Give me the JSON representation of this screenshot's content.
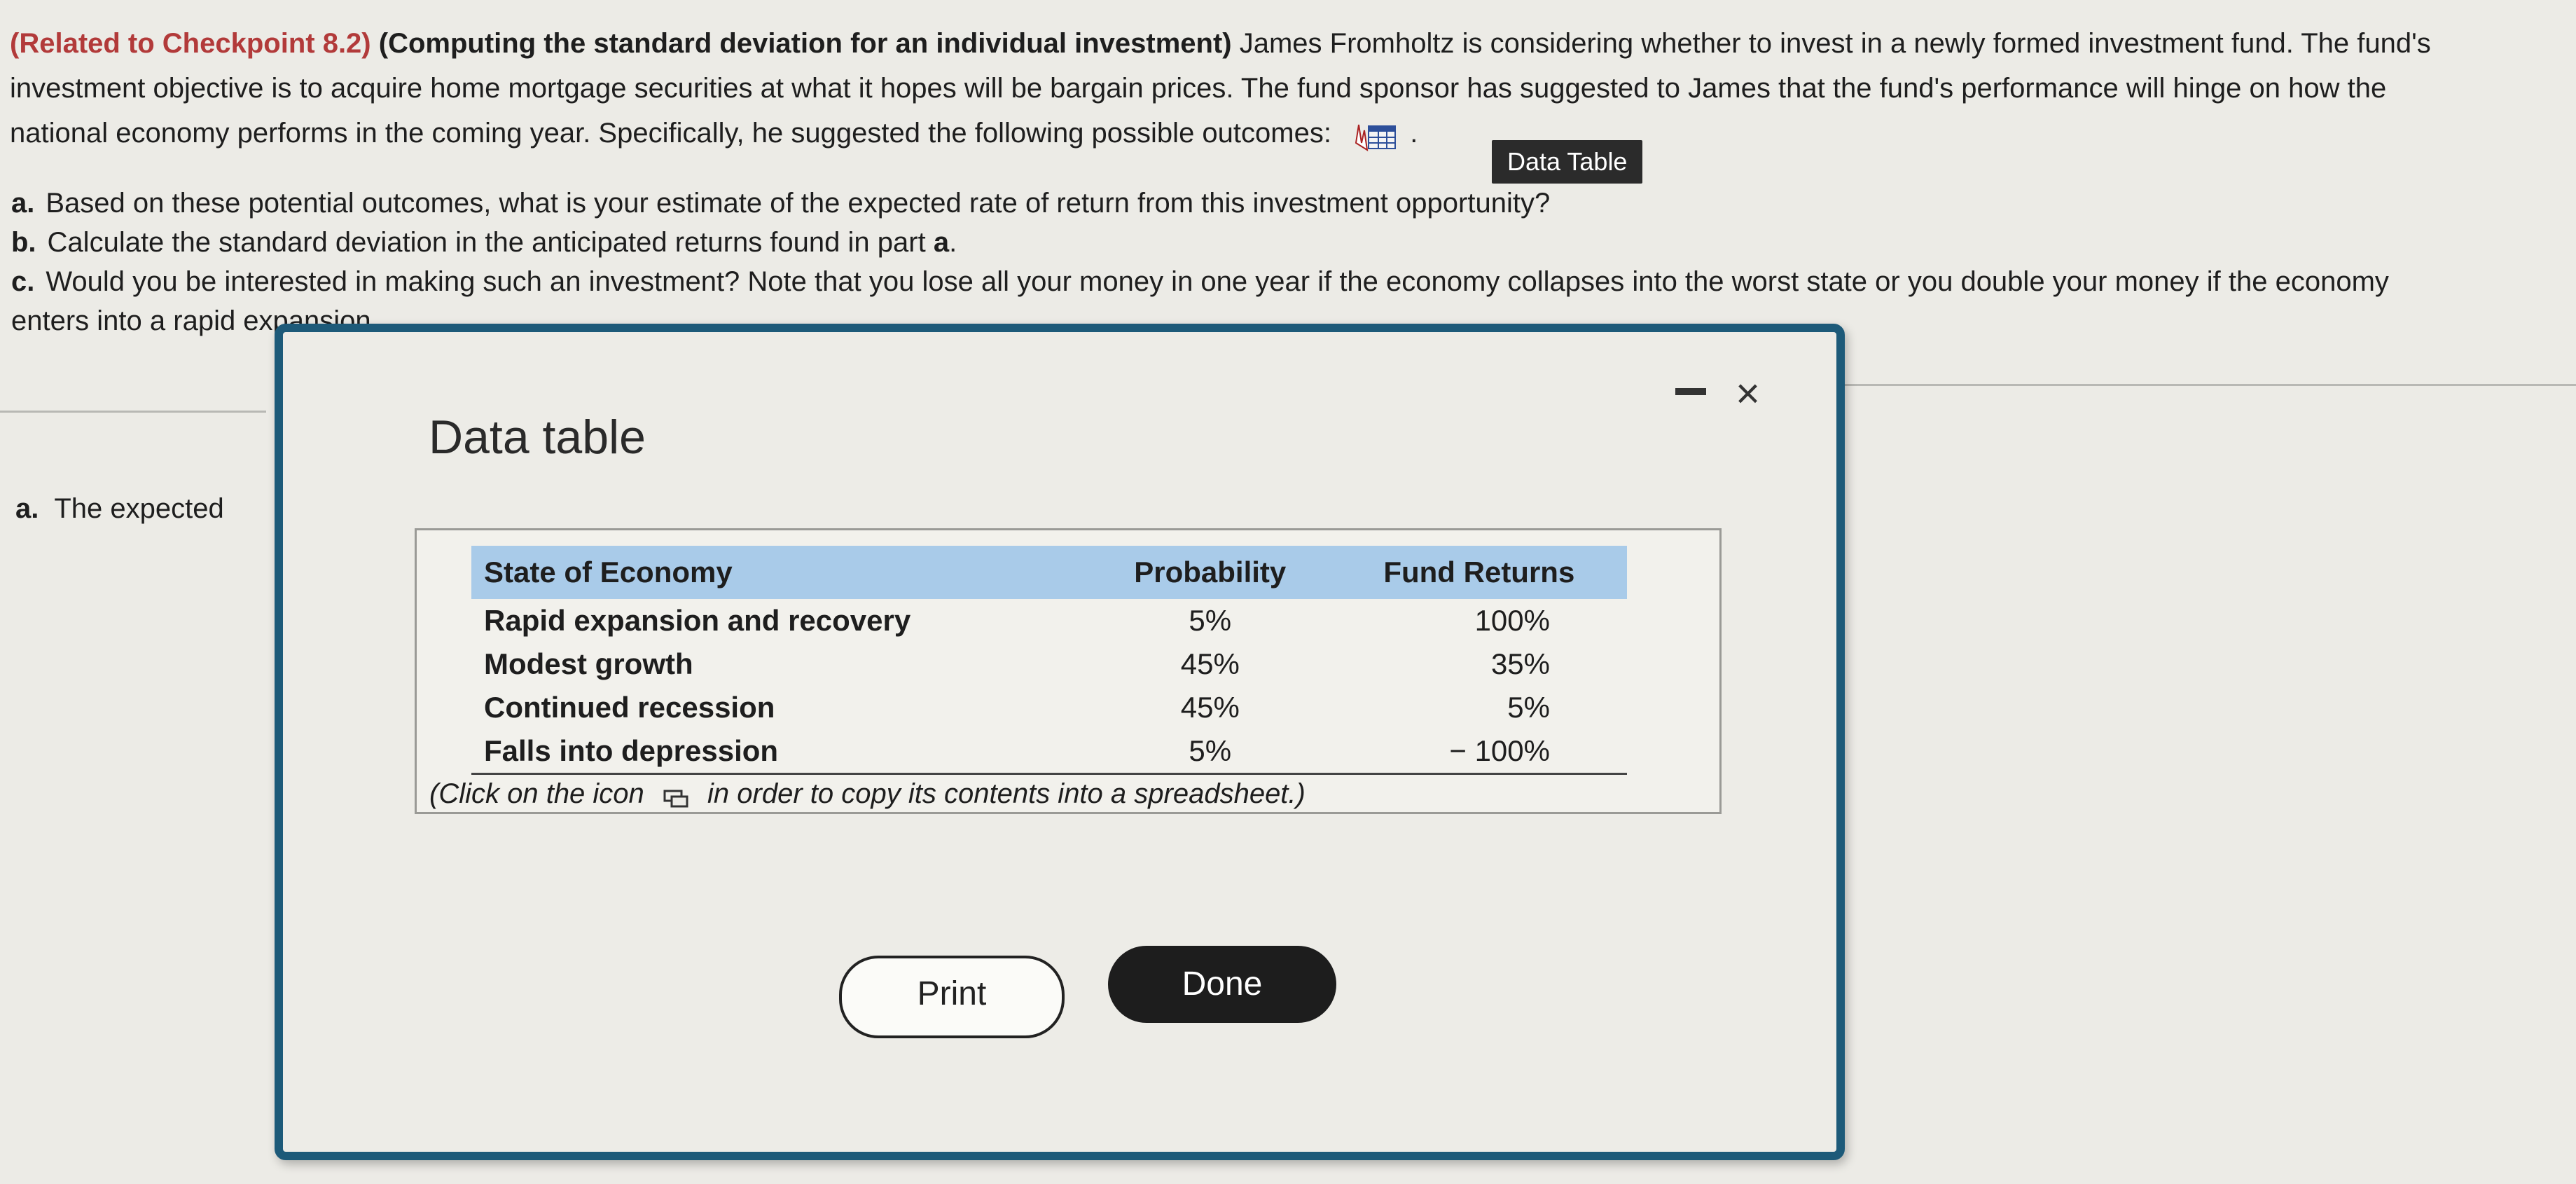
{
  "problem": {
    "ref": "(Related to Checkpoint 8.2)",
    "topic": "(Computing the standard deviation for an individual investment)",
    "body_line1": "James Fromholtz is considering whether to invest in a newly formed investment fund.  The fund's",
    "body_line2": "investment objective is to acquire home mortgage securities at what it hopes will be bargain prices.  The fund sponsor has suggested to James that the fund's performance will hinge on how the",
    "body_line3": "national economy performs in the coming year.  Specifically, he suggested the following possible outcomes:",
    "period": ".",
    "tooltip": "Data Table",
    "part_a_label": "a.",
    "part_a": "Based on these potential outcomes, what is your estimate of the expected rate of return from this investment opportunity?",
    "part_b_label": "b.",
    "part_b_pre": "Calculate the standard deviation in the anticipated returns found in part ",
    "part_b_ref": "a",
    "part_b_post": ".",
    "part_c_label": "c.",
    "part_c_line1": "Would you be interested in making such an investment?  Note that you lose all your money in one year if the economy collapses into the worst state or you double your money if the economy",
    "part_c_line2": "enters into a rapid expansion."
  },
  "answer": {
    "label": "a.",
    "text": "The expected"
  },
  "modal": {
    "title": "Data table",
    "close": "×",
    "hint_pre": "(Click on the icon",
    "hint_post": "in order to copy its contents into a spreadsheet.)",
    "print_label": "Print",
    "done_label": "Done"
  },
  "table": {
    "headers": [
      "State of Economy",
      "Probability",
      "Fund Returns"
    ],
    "rows": [
      {
        "state": "Rapid expansion and recovery",
        "probability": "5%",
        "returns": "100%"
      },
      {
        "state": "Modest growth",
        "probability": "45%",
        "returns": "35%"
      },
      {
        "state": "Continued recession",
        "probability": "45%",
        "returns": "5%"
      },
      {
        "state": "Falls into depression",
        "probability": "5%",
        "returns": "− 100%"
      }
    ]
  },
  "colors": {
    "header_bg": "#a9cbe9",
    "modal_border": "#1d5a79",
    "ref_red": "#b23a3a",
    "done_bg": "#1d1d1d"
  }
}
